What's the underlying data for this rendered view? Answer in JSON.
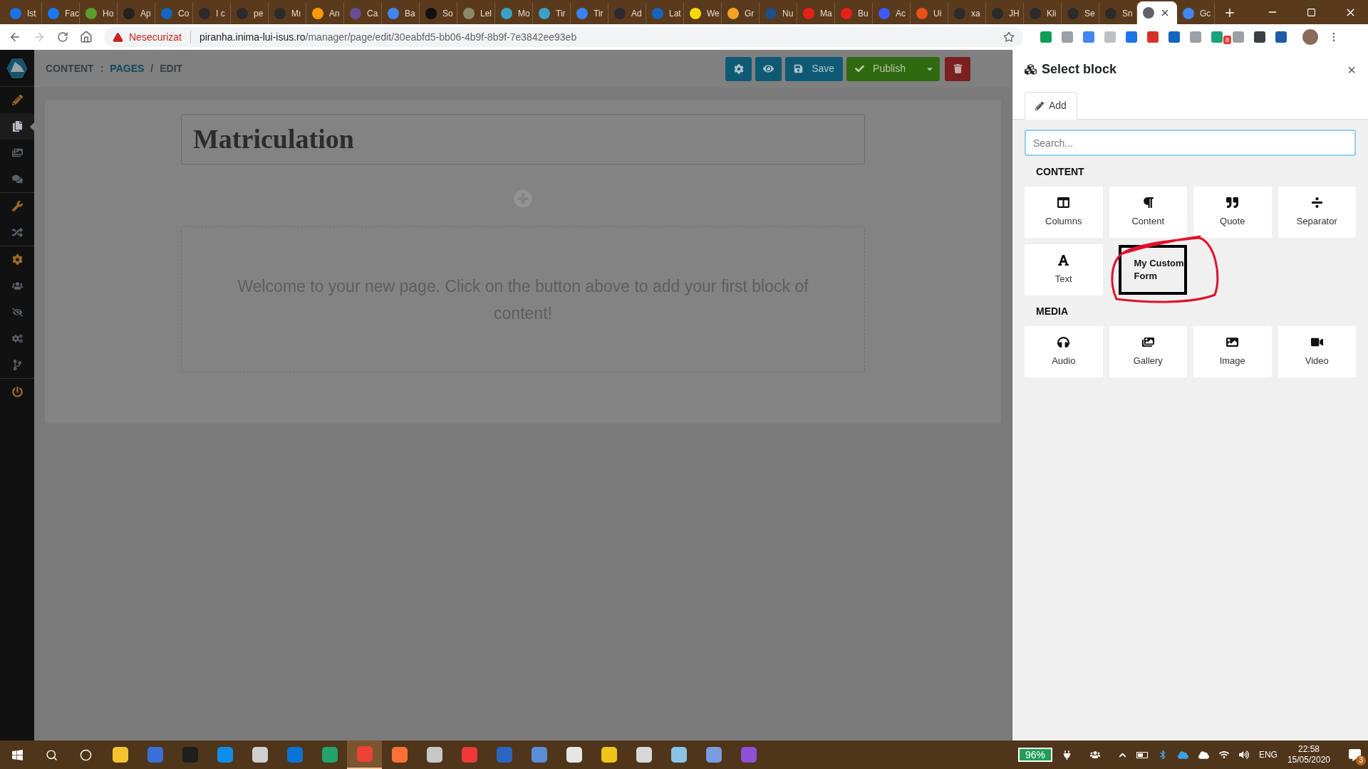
{
  "browser": {
    "tabs": [
      {
        "title": "Ist",
        "color": "#1a73e8",
        "selected": false
      },
      {
        "title": "Fac",
        "color": "#1877f2",
        "selected": false
      },
      {
        "title": "Ho",
        "color": "#5a9e2f",
        "selected": false
      },
      {
        "title": "Ap",
        "color": "#222222",
        "selected": false
      },
      {
        "title": "Co",
        "color": "#1565c0",
        "selected": false
      },
      {
        "title": "I c",
        "color": "#2b2b2b",
        "selected": false
      },
      {
        "title": "pe",
        "color": "#2b2b2b",
        "selected": false
      },
      {
        "title": "Mı",
        "color": "#2b2b2b",
        "selected": false
      },
      {
        "title": "An",
        "color": "#ff9900",
        "selected": false
      },
      {
        "title": "Ca",
        "color": "#6a4c93",
        "selected": false
      },
      {
        "title": "Ba",
        "color": "#4285f4",
        "selected": false
      },
      {
        "title": "So",
        "color": "#111111",
        "selected": false
      },
      {
        "title": "Lel",
        "color": "#8a8a6a",
        "selected": false
      },
      {
        "title": "Mo",
        "color": "#3aa0c8",
        "selected": false
      },
      {
        "title": "Tir",
        "color": "#3aa0c8",
        "selected": false
      },
      {
        "title": "Tir",
        "color": "#3b82f6",
        "selected": false
      },
      {
        "title": "Ad",
        "color": "#2b2b2b",
        "selected": false
      },
      {
        "title": "Lat",
        "color": "#1565c0",
        "selected": false
      },
      {
        "title": "We",
        "color": "#f5d90a",
        "selected": false
      },
      {
        "title": "Gr",
        "color": "#f4a320",
        "selected": false
      },
      {
        "title": "Nu",
        "color": "#1d4e89",
        "selected": false
      },
      {
        "title": "Ma",
        "color": "#e62117",
        "selected": false
      },
      {
        "title": "Bu",
        "color": "#e62117",
        "selected": false
      },
      {
        "title": "Ac",
        "color": "#3d5afe",
        "selected": false
      },
      {
        "title": "Ui",
        "color": "#e8501a",
        "selected": false
      },
      {
        "title": "xa",
        "color": "#2b2b2b",
        "selected": false
      },
      {
        "title": "JH",
        "color": "#2b2b2b",
        "selected": false
      },
      {
        "title": "Kli",
        "color": "#2b2b2b",
        "selected": false
      },
      {
        "title": "Se",
        "color": "#2b2b2b",
        "selected": false
      },
      {
        "title": "Sn",
        "color": "#2b2b2b",
        "selected": false
      },
      {
        "color": "#5f6368",
        "selected": true
      },
      {
        "title": "Gc",
        "color": "#4285f4",
        "selected": false
      }
    ],
    "security_label": "Nesecurizat",
    "url_host": "piranha.inima-lui-isus.ro",
    "url_path": "/manager/page/edit/30eabfd5-bb06-4b9f-8b9f-7e3842ee93eb",
    "extension_badge": "8"
  },
  "app": {
    "sidebar": {
      "items": [
        {
          "color": "#9c6a2a",
          "selected": false
        },
        {
          "color": "#b8b8c8",
          "selected": true
        },
        {
          "color": "#5a6068",
          "selected": false
        },
        {
          "color": "#5a6068",
          "selected": false
        },
        {
          "color": "#9c6a2a",
          "selected": false
        },
        {
          "color": "#5a6068",
          "selected": false
        },
        {
          "color": "#9c6a2a",
          "selected": false
        },
        {
          "color": "#5a6068",
          "selected": false
        },
        {
          "color": "#5a6068",
          "selected": false
        },
        {
          "color": "#5a6068",
          "selected": false
        },
        {
          "color": "#5a6068",
          "selected": false
        },
        {
          "color": "#9c6a2a",
          "selected": false
        }
      ]
    },
    "breadcrumb": {
      "section": "CONTENT",
      "separator": ":",
      "link": "PAGES",
      "divider": "/",
      "current": "EDIT"
    },
    "toolbar": {
      "save": "Save",
      "publish": "Publish"
    },
    "page_title": "Matriculation",
    "empty_message": "Welcome to your new page. Click on the button above to add your first block of content!"
  },
  "panel": {
    "title": "Select block",
    "close": "×",
    "tabs": [
      {
        "label": "Add",
        "selected": true
      }
    ],
    "search": {
      "placeholder": "Search..."
    },
    "sections": [
      {
        "heading": "CONTENT",
        "blocks": [
          {
            "label": "Columns",
            "kind": "icon"
          },
          {
            "label": "Content",
            "kind": "icon"
          },
          {
            "label": "Quote",
            "kind": "icon"
          },
          {
            "label": "Separator",
            "kind": "icon"
          },
          {
            "label": "Text",
            "kind": "icon"
          },
          {
            "label": "My Custom Form",
            "kind": "custom"
          }
        ]
      },
      {
        "heading": "MEDIA",
        "blocks": [
          {
            "label": "Audio",
            "kind": "icon"
          },
          {
            "label": "Gallery",
            "kind": "icon"
          },
          {
            "label": "Image",
            "kind": "icon"
          },
          {
            "label": "Video",
            "kind": "icon"
          }
        ]
      }
    ]
  },
  "taskbar": {
    "apps": [
      {
        "selected": false
      },
      {
        "selected": false
      },
      {
        "selected": false
      },
      {
        "selected": false
      },
      {
        "selected": false
      },
      {
        "selected": false
      },
      {
        "selected": false
      },
      {
        "selected": true
      },
      {
        "selected": false
      },
      {
        "selected": false
      },
      {
        "selected": false
      },
      {
        "selected": false
      },
      {
        "selected": false
      },
      {
        "selected": false
      },
      {
        "selected": false
      },
      {
        "selected": false
      },
      {
        "selected": false
      },
      {
        "selected": false
      },
      {
        "selected": false
      }
    ],
    "battery": "96%",
    "language": "ENG",
    "time": "22:58",
    "date": "15/05/2020",
    "notifications": "3"
  }
}
